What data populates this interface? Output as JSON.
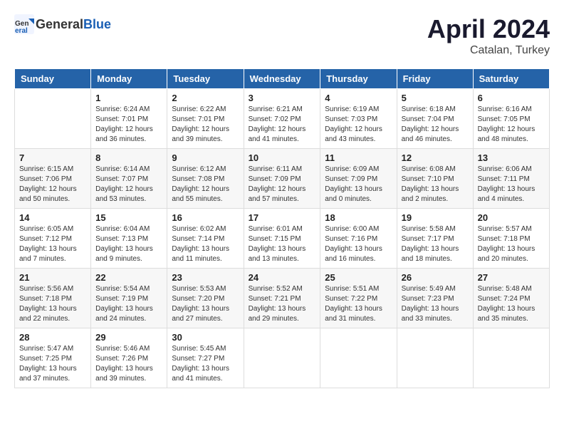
{
  "header": {
    "logo_general": "General",
    "logo_blue": "Blue",
    "month": "April 2024",
    "location": "Catalan, Turkey"
  },
  "weekdays": [
    "Sunday",
    "Monday",
    "Tuesday",
    "Wednesday",
    "Thursday",
    "Friday",
    "Saturday"
  ],
  "weeks": [
    [
      {
        "day": "",
        "sunrise": "",
        "sunset": "",
        "daylight": ""
      },
      {
        "day": "1",
        "sunrise": "Sunrise: 6:24 AM",
        "sunset": "Sunset: 7:01 PM",
        "daylight": "Daylight: 12 hours and 36 minutes."
      },
      {
        "day": "2",
        "sunrise": "Sunrise: 6:22 AM",
        "sunset": "Sunset: 7:01 PM",
        "daylight": "Daylight: 12 hours and 39 minutes."
      },
      {
        "day": "3",
        "sunrise": "Sunrise: 6:21 AM",
        "sunset": "Sunset: 7:02 PM",
        "daylight": "Daylight: 12 hours and 41 minutes."
      },
      {
        "day": "4",
        "sunrise": "Sunrise: 6:19 AM",
        "sunset": "Sunset: 7:03 PM",
        "daylight": "Daylight: 12 hours and 43 minutes."
      },
      {
        "day": "5",
        "sunrise": "Sunrise: 6:18 AM",
        "sunset": "Sunset: 7:04 PM",
        "daylight": "Daylight: 12 hours and 46 minutes."
      },
      {
        "day": "6",
        "sunrise": "Sunrise: 6:16 AM",
        "sunset": "Sunset: 7:05 PM",
        "daylight": "Daylight: 12 hours and 48 minutes."
      }
    ],
    [
      {
        "day": "7",
        "sunrise": "Sunrise: 6:15 AM",
        "sunset": "Sunset: 7:06 PM",
        "daylight": "Daylight: 12 hours and 50 minutes."
      },
      {
        "day": "8",
        "sunrise": "Sunrise: 6:14 AM",
        "sunset": "Sunset: 7:07 PM",
        "daylight": "Daylight: 12 hours and 53 minutes."
      },
      {
        "day": "9",
        "sunrise": "Sunrise: 6:12 AM",
        "sunset": "Sunset: 7:08 PM",
        "daylight": "Daylight: 12 hours and 55 minutes."
      },
      {
        "day": "10",
        "sunrise": "Sunrise: 6:11 AM",
        "sunset": "Sunset: 7:09 PM",
        "daylight": "Daylight: 12 hours and 57 minutes."
      },
      {
        "day": "11",
        "sunrise": "Sunrise: 6:09 AM",
        "sunset": "Sunset: 7:09 PM",
        "daylight": "Daylight: 13 hours and 0 minutes."
      },
      {
        "day": "12",
        "sunrise": "Sunrise: 6:08 AM",
        "sunset": "Sunset: 7:10 PM",
        "daylight": "Daylight: 13 hours and 2 minutes."
      },
      {
        "day": "13",
        "sunrise": "Sunrise: 6:06 AM",
        "sunset": "Sunset: 7:11 PM",
        "daylight": "Daylight: 13 hours and 4 minutes."
      }
    ],
    [
      {
        "day": "14",
        "sunrise": "Sunrise: 6:05 AM",
        "sunset": "Sunset: 7:12 PM",
        "daylight": "Daylight: 13 hours and 7 minutes."
      },
      {
        "day": "15",
        "sunrise": "Sunrise: 6:04 AM",
        "sunset": "Sunset: 7:13 PM",
        "daylight": "Daylight: 13 hours and 9 minutes."
      },
      {
        "day": "16",
        "sunrise": "Sunrise: 6:02 AM",
        "sunset": "Sunset: 7:14 PM",
        "daylight": "Daylight: 13 hours and 11 minutes."
      },
      {
        "day": "17",
        "sunrise": "Sunrise: 6:01 AM",
        "sunset": "Sunset: 7:15 PM",
        "daylight": "Daylight: 13 hours and 13 minutes."
      },
      {
        "day": "18",
        "sunrise": "Sunrise: 6:00 AM",
        "sunset": "Sunset: 7:16 PM",
        "daylight": "Daylight: 13 hours and 16 minutes."
      },
      {
        "day": "19",
        "sunrise": "Sunrise: 5:58 AM",
        "sunset": "Sunset: 7:17 PM",
        "daylight": "Daylight: 13 hours and 18 minutes."
      },
      {
        "day": "20",
        "sunrise": "Sunrise: 5:57 AM",
        "sunset": "Sunset: 7:18 PM",
        "daylight": "Daylight: 13 hours and 20 minutes."
      }
    ],
    [
      {
        "day": "21",
        "sunrise": "Sunrise: 5:56 AM",
        "sunset": "Sunset: 7:18 PM",
        "daylight": "Daylight: 13 hours and 22 minutes."
      },
      {
        "day": "22",
        "sunrise": "Sunrise: 5:54 AM",
        "sunset": "Sunset: 7:19 PM",
        "daylight": "Daylight: 13 hours and 24 minutes."
      },
      {
        "day": "23",
        "sunrise": "Sunrise: 5:53 AM",
        "sunset": "Sunset: 7:20 PM",
        "daylight": "Daylight: 13 hours and 27 minutes."
      },
      {
        "day": "24",
        "sunrise": "Sunrise: 5:52 AM",
        "sunset": "Sunset: 7:21 PM",
        "daylight": "Daylight: 13 hours and 29 minutes."
      },
      {
        "day": "25",
        "sunrise": "Sunrise: 5:51 AM",
        "sunset": "Sunset: 7:22 PM",
        "daylight": "Daylight: 13 hours and 31 minutes."
      },
      {
        "day": "26",
        "sunrise": "Sunrise: 5:49 AM",
        "sunset": "Sunset: 7:23 PM",
        "daylight": "Daylight: 13 hours and 33 minutes."
      },
      {
        "day": "27",
        "sunrise": "Sunrise: 5:48 AM",
        "sunset": "Sunset: 7:24 PM",
        "daylight": "Daylight: 13 hours and 35 minutes."
      }
    ],
    [
      {
        "day": "28",
        "sunrise": "Sunrise: 5:47 AM",
        "sunset": "Sunset: 7:25 PM",
        "daylight": "Daylight: 13 hours and 37 minutes."
      },
      {
        "day": "29",
        "sunrise": "Sunrise: 5:46 AM",
        "sunset": "Sunset: 7:26 PM",
        "daylight": "Daylight: 13 hours and 39 minutes."
      },
      {
        "day": "30",
        "sunrise": "Sunrise: 5:45 AM",
        "sunset": "Sunset: 7:27 PM",
        "daylight": "Daylight: 13 hours and 41 minutes."
      },
      {
        "day": "",
        "sunrise": "",
        "sunset": "",
        "daylight": ""
      },
      {
        "day": "",
        "sunrise": "",
        "sunset": "",
        "daylight": ""
      },
      {
        "day": "",
        "sunrise": "",
        "sunset": "",
        "daylight": ""
      },
      {
        "day": "",
        "sunrise": "",
        "sunset": "",
        "daylight": ""
      }
    ]
  ]
}
